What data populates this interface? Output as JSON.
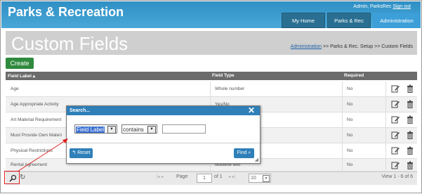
{
  "app": {
    "brand": "Parks & Recreation"
  },
  "user": {
    "name": "Admin, ParksRec",
    "signout": "Sign out"
  },
  "tabs": [
    {
      "label": "My Home"
    },
    {
      "label": "Parks & Rec"
    },
    {
      "label": "Administration",
      "active": true
    }
  ],
  "page": {
    "title": "Custom Fields"
  },
  "breadcrumb": {
    "link": "Administration",
    "rest": ">> Parks & Rec. Setup >> Custom Fields"
  },
  "actions": {
    "create_label": "Create"
  },
  "grid": {
    "columns": {
      "label": "Field Label",
      "type": "Field Type",
      "required": "Required"
    },
    "rows": [
      {
        "label": "Age",
        "type": "Whole number",
        "required": "No"
      },
      {
        "label": "Age Appropriate Activity",
        "type": "Yes/No",
        "required": "No"
      },
      {
        "label": "Art Material Requirement",
        "type": "",
        "required": "No"
      },
      {
        "label": "Must Provide Own Materi",
        "type": "",
        "required": "No"
      },
      {
        "label": "Physical Restrictions",
        "type": "",
        "required": "No"
      },
      {
        "label": "Rental Agreement",
        "type": "Multiline text",
        "required": "No"
      }
    ]
  },
  "pager": {
    "page_label": "Page",
    "page_value": "1",
    "of_label": "of 1",
    "page_size": "10",
    "view_label": "View 1 - 6 of 6"
  },
  "search_dialog": {
    "title": "Search...",
    "field_select": "Field Label",
    "operator_select": "contains",
    "value": "",
    "reset_label": "Reset",
    "find_label": "Find"
  },
  "colors": {
    "header": "#3a9fd5",
    "tab_active": "#3c9fd8",
    "create": "#2f8a3e",
    "annotation_arrow": "#e02020"
  }
}
